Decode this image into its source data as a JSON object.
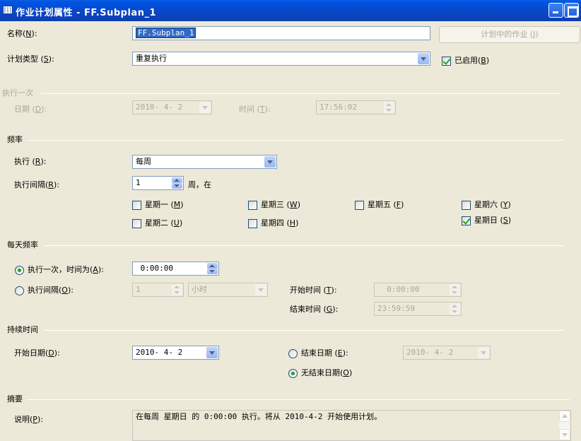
{
  "window": {
    "title": "作业计划属性 - FF.Subplan_1"
  },
  "name": {
    "label": "名称",
    "key": "N",
    "value": "FF.Subplan_1"
  },
  "jobs_button": {
    "label": "计划中的作业",
    "key": "J"
  },
  "schedule_type": {
    "label": "计划类型",
    "key": "S",
    "value": "重复执行"
  },
  "enabled": {
    "label": "已启用",
    "key": "B",
    "checked": true
  },
  "once": {
    "header": "执行一次",
    "date_label": "日期",
    "date_key": "D",
    "date_value": "2010- 4- 2",
    "time_label": "时间",
    "time_key": "T",
    "time_value": "17:56:02"
  },
  "frequency": {
    "header": "频率",
    "occurs_label": "执行",
    "occurs_key": "R",
    "occurs_value": "每周",
    "interval_label": "执行间隔",
    "interval_key": "R",
    "interval_value": "1",
    "interval_suffix": "周，在",
    "days": [
      {
        "label": "星期一",
        "key": "M",
        "checked": false
      },
      {
        "label": "星期二",
        "key": "U",
        "checked": false
      },
      {
        "label": "星期三",
        "key": "W",
        "checked": false
      },
      {
        "label": "星期四",
        "key": "H",
        "checked": false
      },
      {
        "label": "星期五",
        "key": "F",
        "checked": false
      },
      {
        "label": "星期六",
        "key": "Y",
        "checked": false
      },
      {
        "label": "星期日",
        "key": "S",
        "checked": true
      }
    ]
  },
  "daily": {
    "header": "每天频率",
    "once_label": "执行一次，时间为",
    "once_key": "A",
    "once_value": "0:00:00",
    "once_selected": true,
    "every_label": "执行间隔",
    "every_key": "O",
    "every_value": "1",
    "every_unit": "小时",
    "every_selected": false,
    "start_label": "开始时间",
    "start_key": "T",
    "start_value": "0:00:00",
    "end_label": "结束时间",
    "end_key": "G",
    "end_value": "23:59:59"
  },
  "duration": {
    "header": "持续时间",
    "start_label": "开始日期",
    "start_key": "D",
    "start_value": "2010- 4- 2",
    "end_label": "结束日期",
    "end_key": "E",
    "end_value": "2010- 4- 2",
    "end_selected": false,
    "noend_label": "无结束日期",
    "noend_key": "O",
    "noend_selected": true
  },
  "summary": {
    "header": "摘要",
    "desc_label": "说明",
    "desc_key": "P",
    "desc_value": "在每周 星期日 的 0:00:00 执行。将从 2010-4-2 开始使用计划。"
  }
}
